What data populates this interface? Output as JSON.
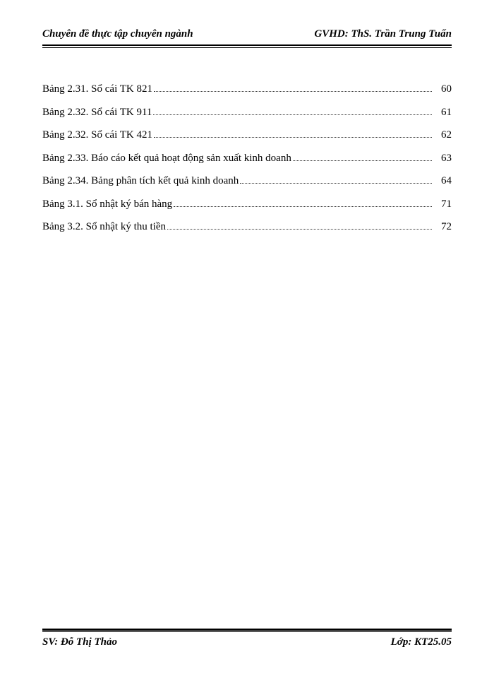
{
  "header": {
    "left": "Chuyên đề thực tập chuyên ngành",
    "right": "GVHD: ThS. Trần Trung Tuấn"
  },
  "toc": [
    {
      "label": "Bảng 2.31. Sổ cái TK 821",
      "page": "60"
    },
    {
      "label": "Bảng 2.32. Sổ cái TK 911",
      "page": "61"
    },
    {
      "label": "Bảng 2.32. Sổ cái TK 421",
      "page": "62"
    },
    {
      "label": "Bảng 2.33. Báo cáo kết quả hoạt động sản xuất kinh doanh",
      "page": "63"
    },
    {
      "label": "Bảng 2.34. Bảng phân tích kết quả kinh doanh",
      "page": "64"
    },
    {
      "label": "Bảng 3.1. Sổ nhật ký bán hàng",
      "page": "71"
    },
    {
      "label": "Bảng 3.2. Sổ nhật ký thu tiền",
      "page": "72"
    }
  ],
  "footer": {
    "left": "SV: Đỗ Thị Thảo",
    "right": "Lớp: KT25.05"
  }
}
